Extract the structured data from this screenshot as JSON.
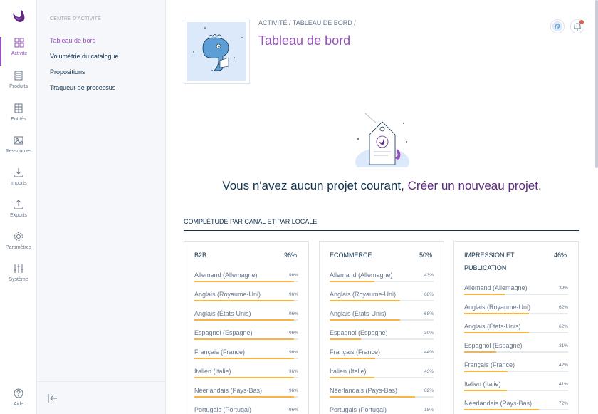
{
  "rail": {
    "items": [
      {
        "label": "Activité",
        "icon": "activity-icon",
        "active": true
      },
      {
        "label": "Produits",
        "icon": "products-icon"
      },
      {
        "label": "Entités",
        "icon": "entities-icon"
      },
      {
        "label": "Ressources",
        "icon": "assets-icon"
      },
      {
        "label": "Imports",
        "icon": "import-icon"
      },
      {
        "label": "Exports",
        "icon": "export-icon"
      },
      {
        "label": "Paramètres",
        "icon": "settings-icon"
      },
      {
        "label": "Système",
        "icon": "system-icon"
      }
    ],
    "help": {
      "label": "Aide",
      "icon": "help-icon"
    }
  },
  "panel": {
    "title": "Centre d'activité",
    "links": [
      "Tableau de bord",
      "Volumétrie du catalogue",
      "Propositions",
      "Traqueur de processus"
    ]
  },
  "header": {
    "breadcrumb": [
      "ACTIVITÉ",
      "TABLEAU DE BORD"
    ],
    "title": "Tableau de bord"
  },
  "empty": {
    "message": "Vous n'avez aucun projet courant,",
    "link": "Créer un nouveau projet"
  },
  "completeness": {
    "title": "Complétude par canal et par locale",
    "channels": [
      {
        "name": "B2B",
        "pct": "96%",
        "locales": [
          {
            "name": "Allemand (Allemagne)",
            "pct": "96%",
            "value": 96
          },
          {
            "name": "Anglais (Royaume-Uni)",
            "pct": "96%",
            "value": 96
          },
          {
            "name": "Anglais (États-Unis)",
            "pct": "96%",
            "value": 96
          },
          {
            "name": "Espagnol (Espagne)",
            "pct": "96%",
            "value": 96
          },
          {
            "name": "Français (France)",
            "pct": "96%",
            "value": 96
          },
          {
            "name": "Italien (Italie)",
            "pct": "96%",
            "value": 96
          },
          {
            "name": "Néerlandais (Pays-Bas)",
            "pct": "96%",
            "value": 96
          },
          {
            "name": "Portugais (Portugal)",
            "pct": "96%",
            "value": 96
          }
        ]
      },
      {
        "name": "Ecommerce",
        "pct": "50%",
        "locales": [
          {
            "name": "Allemand (Allemagne)",
            "pct": "43%",
            "value": 43
          },
          {
            "name": "Anglais (Royaume-Uni)",
            "pct": "68%",
            "value": 68
          },
          {
            "name": "Anglais (États-Unis)",
            "pct": "68%",
            "value": 68
          },
          {
            "name": "Espagnol (Espagne)",
            "pct": "30%",
            "value": 30
          },
          {
            "name": "Français (France)",
            "pct": "44%",
            "value": 44
          },
          {
            "name": "Italien (Italie)",
            "pct": "43%",
            "value": 43
          },
          {
            "name": "Néerlandais (Pays-Bas)",
            "pct": "82%",
            "value": 82
          },
          {
            "name": "Portugais (Portugal)",
            "pct": "18%",
            "value": 18
          }
        ]
      },
      {
        "name": "Impression et publication",
        "pct": "46%",
        "locales": [
          {
            "name": "Allemand (Allemagne)",
            "pct": "39%",
            "value": 39
          },
          {
            "name": "Anglais (Royaume-Uni)",
            "pct": "62%",
            "value": 62
          },
          {
            "name": "Anglais (États-Unis)",
            "pct": "62%",
            "value": 62
          },
          {
            "name": "Espagnol (Espagne)",
            "pct": "31%",
            "value": 31
          },
          {
            "name": "Français (France)",
            "pct": "42%",
            "value": 42
          },
          {
            "name": "Italien (Italie)",
            "pct": "41%",
            "value": 41
          },
          {
            "name": "Néerlandais (Pays-Bas)",
            "pct": "72%",
            "value": 72
          }
        ]
      }
    ]
  },
  "colors": {
    "accent": "#9452ba",
    "link": "#5d2a7e",
    "bar": "#f9b53f",
    "text": "#11324d"
  }
}
